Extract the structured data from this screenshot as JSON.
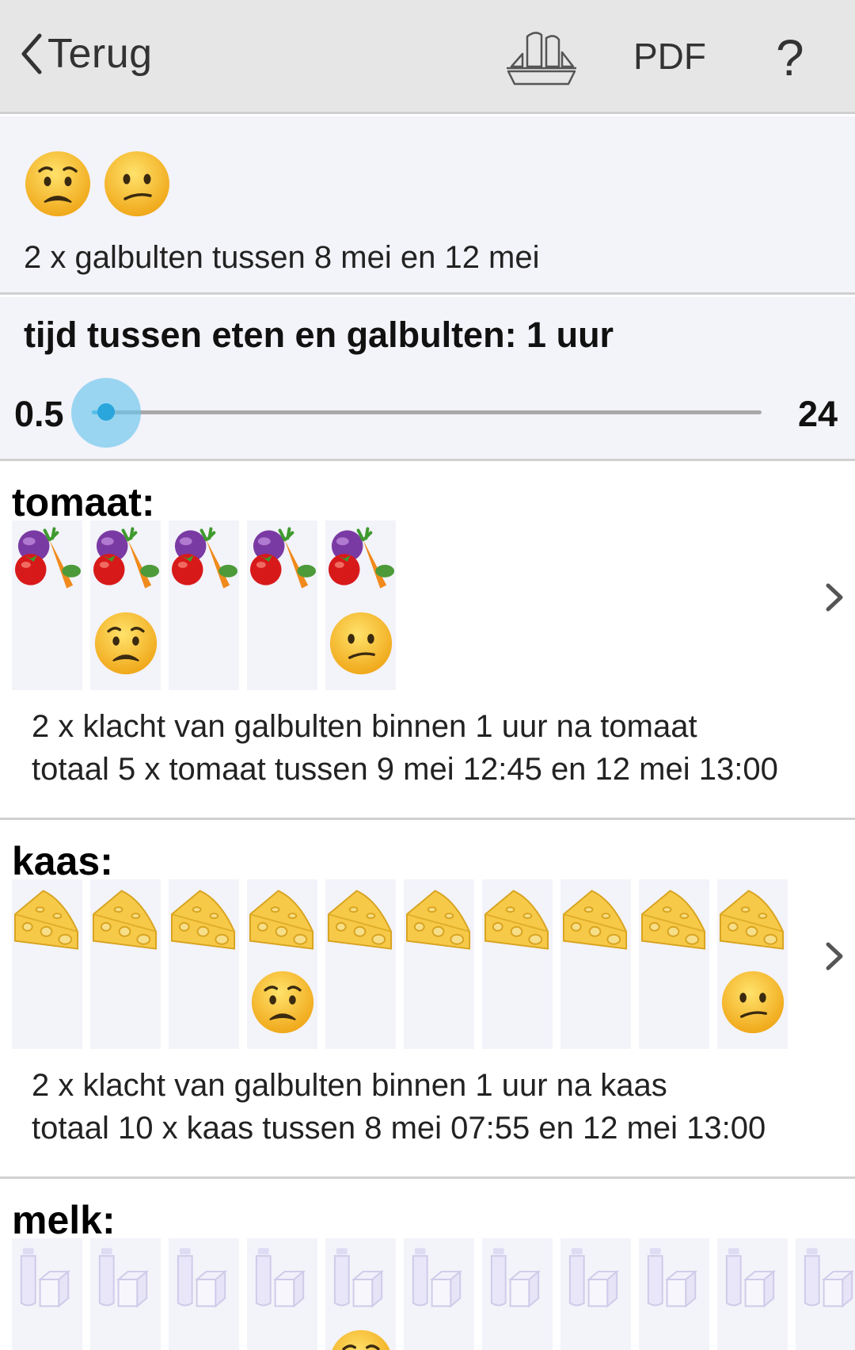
{
  "nav": {
    "back_label": "Terug",
    "pdf_label": "PDF",
    "help_label": "?"
  },
  "summary": {
    "faces": [
      "worried-face",
      "confused-face"
    ],
    "text": "2 x galbulten tussen 8 mei en 12 mei"
  },
  "time": {
    "title": "tijd tussen eten en galbulten: 1 uur",
    "min_label": "0.5",
    "max_label": "24",
    "value_hours": 1,
    "min": 0.5,
    "max": 24
  },
  "foods": [
    {
      "name": "tomaat:",
      "icon": "vegetables-icon",
      "reactions": [
        null,
        "worried",
        null,
        null,
        "confused"
      ],
      "line1": "2 x  klacht van galbulten binnen 1 uur na tomaat",
      "line2": "totaal 5 x tomaat tussen 9 mei 12:45 en 12 mei 13:00"
    },
    {
      "name": "kaas:",
      "icon": "cheese-icon",
      "reactions": [
        null,
        null,
        null,
        "worried",
        null,
        null,
        null,
        null,
        null,
        "confused"
      ],
      "line1": "2 x  klacht van galbulten binnen 1 uur na kaas",
      "line2": "totaal 10 x kaas tussen 8 mei 07:55 en 12 mei 13:00"
    },
    {
      "name": "melk:",
      "icon": "milk-icon",
      "reactions": [
        null,
        null,
        null,
        null,
        "worried",
        null,
        null,
        null,
        null,
        null,
        null
      ],
      "line1": "",
      "line2": ""
    }
  ],
  "colors": {
    "accent": "#39b3e4",
    "panel": "#f3f3fa",
    "topbar": "#e6e6e6"
  }
}
